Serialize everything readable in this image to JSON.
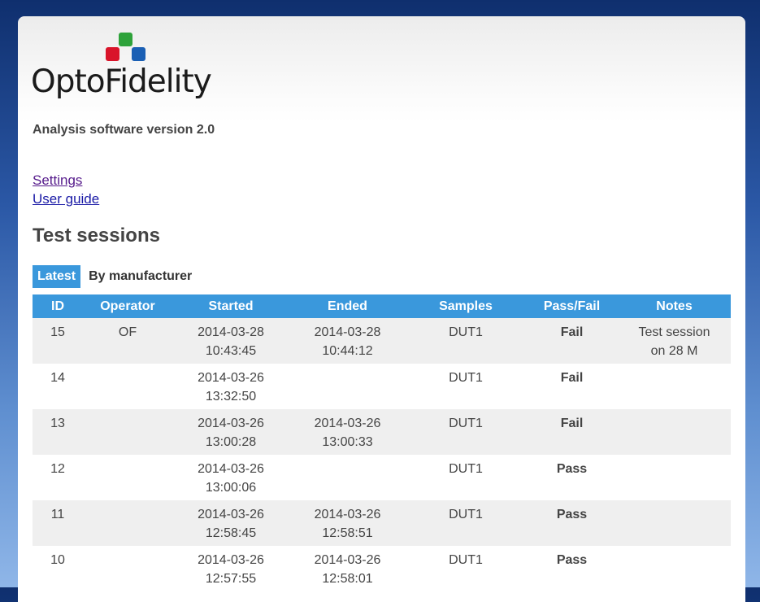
{
  "logo": {
    "text": "OptoFidelity"
  },
  "version_text": "Analysis software version 2.0",
  "links": [
    {
      "label": "Settings"
    },
    {
      "label": "User guide"
    }
  ],
  "heading": "Test sessions",
  "tabs": [
    {
      "label": "Latest",
      "active": true
    },
    {
      "label": "By manufacturer",
      "active": false
    }
  ],
  "table": {
    "headers": [
      "ID",
      "Operator",
      "Started",
      "Ended",
      "Samples",
      "Pass/Fail",
      "Notes"
    ],
    "rows": [
      {
        "id": "15",
        "operator": "OF",
        "started_date": "2014-03-28",
        "started_time": "10:43:45",
        "ended_date": "2014-03-28",
        "ended_time": "10:44:12",
        "samples": "DUT1",
        "result": "Fail",
        "notes_1": "Test session",
        "notes_2": "on 28 M"
      },
      {
        "id": "14",
        "operator": "",
        "started_date": "2014-03-26",
        "started_time": "13:32:50",
        "ended_date": "",
        "ended_time": "",
        "samples": "DUT1",
        "result": "Fail",
        "notes_1": "",
        "notes_2": ""
      },
      {
        "id": "13",
        "operator": "",
        "started_date": "2014-03-26",
        "started_time": "13:00:28",
        "ended_date": "2014-03-26",
        "ended_time": "13:00:33",
        "samples": "DUT1",
        "result": "Fail",
        "notes_1": "",
        "notes_2": ""
      },
      {
        "id": "12",
        "operator": "",
        "started_date": "2014-03-26",
        "started_time": "13:00:06",
        "ended_date": "",
        "ended_time": "",
        "samples": "DUT1",
        "result": "Pass",
        "notes_1": "",
        "notes_2": ""
      },
      {
        "id": "11",
        "operator": "",
        "started_date": "2014-03-26",
        "started_time": "12:58:45",
        "ended_date": "2014-03-26",
        "ended_time": "12:58:51",
        "samples": "DUT1",
        "result": "Pass",
        "notes_1": "",
        "notes_2": ""
      },
      {
        "id": "10",
        "operator": "",
        "started_date": "2014-03-26",
        "started_time": "12:57:55",
        "ended_date": "2014-03-26",
        "ended_time": "12:58:01",
        "samples": "DUT1",
        "result": "Pass",
        "notes_1": "",
        "notes_2": ""
      }
    ]
  },
  "colors": {
    "accent": "#3a98dc",
    "fail": "#e3121d",
    "pass": "#1fe01f",
    "logo_green": "#2ea23a",
    "logo_red": "#d9142a",
    "logo_blue": "#1a5fb4"
  }
}
